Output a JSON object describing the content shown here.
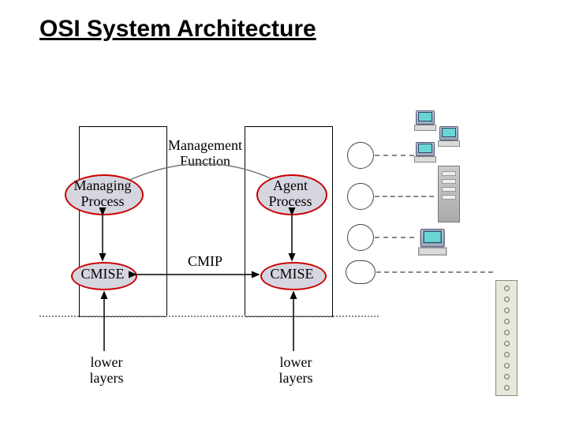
{
  "title": "OSI System Architecture",
  "mgmt_function": "Management\nFunction",
  "managing_process": "Managing\nProcess",
  "agent_process": "Agent\nProcess",
  "cmise_left": "CMISE",
  "cmise_right": "CMISE",
  "cmip": "CMIP",
  "lower_layers_left": "lower\nlayers",
  "lower_layers_right": "lower\nlayers"
}
